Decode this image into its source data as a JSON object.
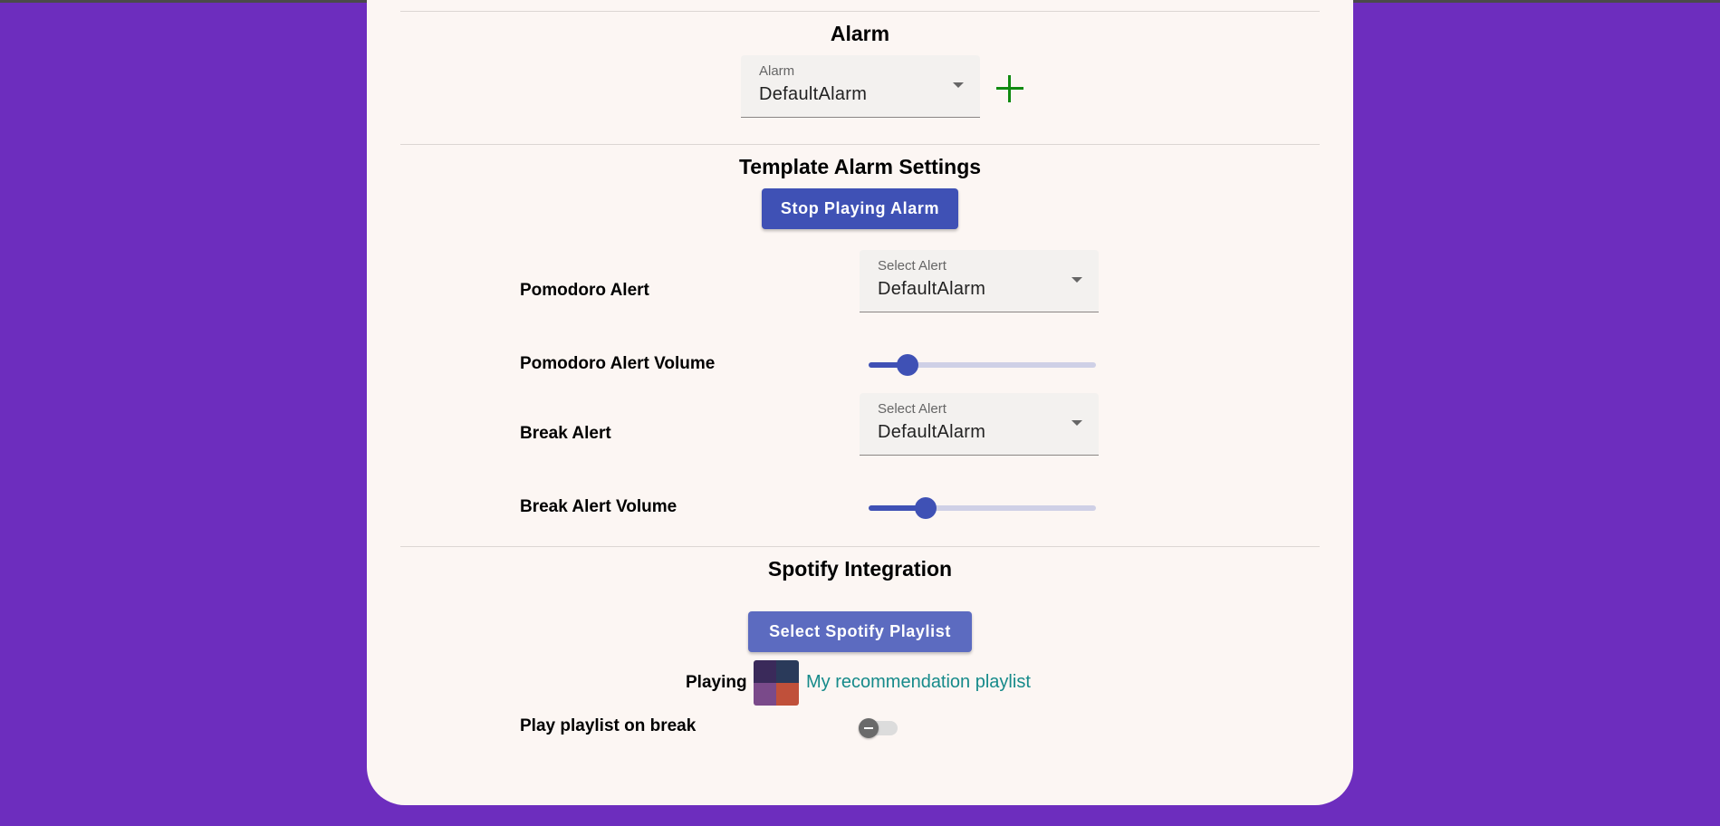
{
  "alarm_section": {
    "title": "Alarm",
    "select": {
      "label": "Alarm",
      "value": "DefaultAlarm"
    },
    "add_icon": "plus-icon"
  },
  "template_section": {
    "title": "Template Alarm Settings",
    "stop_button": "Stop Playing Alarm",
    "pomodoro_alert": {
      "label": "Pomodoro Alert",
      "select_label": "Select Alert",
      "value": "DefaultAlarm"
    },
    "pomodoro_volume": {
      "label": "Pomodoro Alert Volume",
      "level": 0.17
    },
    "break_alert": {
      "label": "Break Alert",
      "select_label": "Select Alert",
      "value": "DefaultAlarm"
    },
    "break_volume": {
      "label": "Break Alert Volume",
      "level": 0.25
    }
  },
  "spotify_section": {
    "title": "Spotify Integration",
    "select_button": "Select Spotify Playlist",
    "playing_label": "Playing",
    "playlist_name": "My recommendation playlist",
    "play_on_break": {
      "label": "Play playlist on break",
      "enabled": false
    }
  },
  "colors": {
    "background": "#6d2dbe",
    "card": "#fcf6f3",
    "primary": "#3f51b5",
    "primary_light": "#5c6bc0",
    "add_icon": "#108a10",
    "link": "#168a8a"
  }
}
